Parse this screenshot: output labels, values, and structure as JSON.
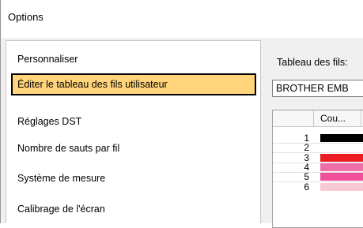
{
  "window": {
    "title": "Options"
  },
  "sidebar": {
    "items": [
      {
        "label": "Personnaliser"
      },
      {
        "label": "Éditer le tableau des fils utilisateur",
        "selected": true
      },
      {
        "label": "Réglages DST"
      },
      {
        "label": "Nombre de sauts par fil"
      },
      {
        "label": "Système de mesure"
      },
      {
        "label": "Calibrage de l'écran"
      }
    ]
  },
  "panel": {
    "thread_table_label": "Tableau des fils:",
    "thread_table_value": "BROTHER EMB",
    "grid": {
      "column_header": "Cou...",
      "rows": [
        {
          "num": "1",
          "color": "#000000"
        },
        {
          "num": "2",
          "color": "#ffffff"
        },
        {
          "num": "3",
          "color": "#ec1c24"
        },
        {
          "num": "4",
          "color": "#f06ea8"
        },
        {
          "num": "5",
          "color": "#f0509a"
        },
        {
          "num": "6",
          "color": "#f8c8d4"
        }
      ]
    }
  }
}
